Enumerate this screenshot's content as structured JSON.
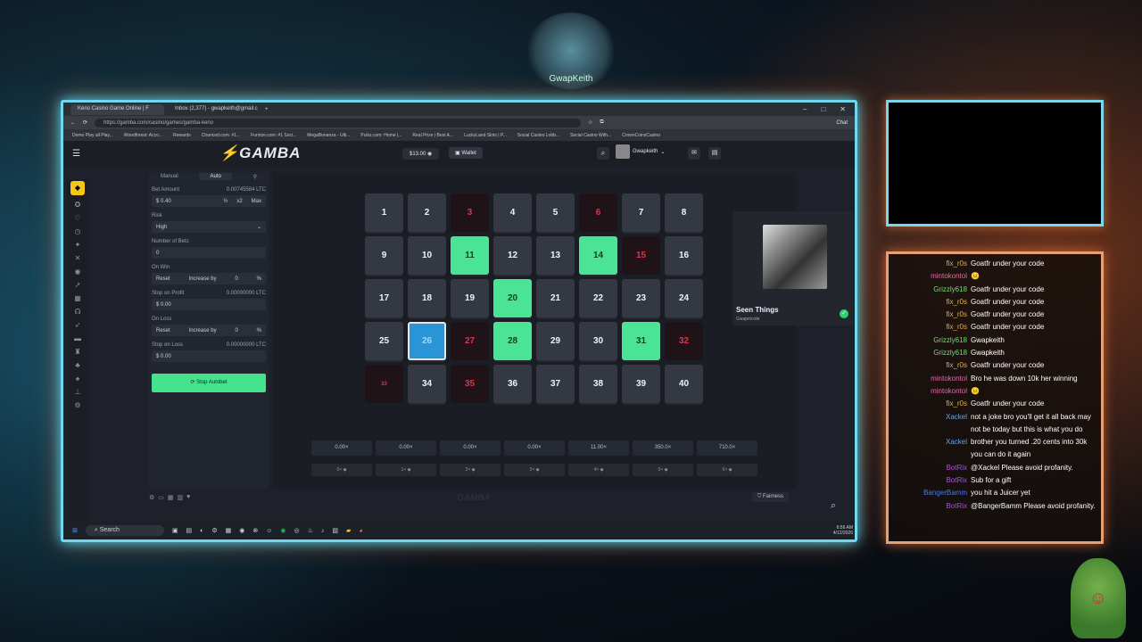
{
  "stream": {
    "logo_text": "GwapKeith"
  },
  "browser": {
    "tabs": [
      {
        "label": "Keno Casino Game Online | F"
      },
      {
        "label": "Inbox (2,377) - gwapkeith@gmail.c"
      }
    ],
    "url": "https://gamba.com/casino/games/gamba-keno",
    "bookmarks": [
      "Demo Play all Play...",
      "Woodforest: Acco...",
      "Rewards",
      "Chanced.com: #1...",
      "Funrize.com: #1 Soci...",
      "MegaBonanza - Ulti...",
      "Pulsz.com: Home |...",
      "Real Prize | Best A...",
      "LuckyLand Slots | P...",
      "Social Casino Lobb...",
      "Social Casino With...",
      "CrownCoinsCasino"
    ],
    "chat_label": "Chat"
  },
  "site": {
    "brand": "GAMBA",
    "balance": "$13.00",
    "wallet_label": "Wallet",
    "username": "Gwapkeith"
  },
  "bet_panel": {
    "tab_manual": "Manual",
    "tab_auto": "Auto",
    "bet_amount_label": "Bet Amount",
    "bet_amount_ltc": "0.00745584 LTC",
    "bet_amount_value": "$ 0.40",
    "half": "½",
    "double": "x2",
    "max": "Max",
    "risk_label": "Risk",
    "risk_value": "High",
    "num_bets_label": "Number of Bets",
    "num_bets_value": "0",
    "on_win_label": "On Win",
    "on_win_reset": "Reset",
    "on_win_increase": "Increase by",
    "on_win_value": "0",
    "on_win_pct": "%",
    "stop_profit_label": "Stop on Profit",
    "stop_profit_ltc": "0.00000000 LTC",
    "stop_profit_value": "$ 0.00",
    "on_loss_label": "On Loss",
    "on_loss_reset": "Reset",
    "on_loss_increase": "Increase by",
    "on_loss_value": "0",
    "on_loss_pct": "%",
    "stop_loss_label": "Stop on Loss",
    "stop_loss_ltc": "0.00000000 LTC",
    "stop_loss_value": "$ 0.00",
    "stop_button": "Stop Autobet"
  },
  "keno": {
    "cells": [
      {
        "n": "1",
        "s": ""
      },
      {
        "n": "2",
        "s": ""
      },
      {
        "n": "3",
        "s": "drawn"
      },
      {
        "n": "4",
        "s": ""
      },
      {
        "n": "5",
        "s": ""
      },
      {
        "n": "6",
        "s": "drawn"
      },
      {
        "n": "7",
        "s": ""
      },
      {
        "n": "8",
        "s": ""
      },
      {
        "n": "9",
        "s": ""
      },
      {
        "n": "10",
        "s": ""
      },
      {
        "n": "11",
        "s": "hit"
      },
      {
        "n": "12",
        "s": ""
      },
      {
        "n": "13",
        "s": ""
      },
      {
        "n": "14",
        "s": "hit"
      },
      {
        "n": "15",
        "s": "drawn"
      },
      {
        "n": "16",
        "s": ""
      },
      {
        "n": "17",
        "s": ""
      },
      {
        "n": "18",
        "s": ""
      },
      {
        "n": "19",
        "s": ""
      },
      {
        "n": "20",
        "s": "hit"
      },
      {
        "n": "21",
        "s": ""
      },
      {
        "n": "22",
        "s": ""
      },
      {
        "n": "23",
        "s": ""
      },
      {
        "n": "24",
        "s": ""
      },
      {
        "n": "25",
        "s": ""
      },
      {
        "n": "26",
        "s": "sel"
      },
      {
        "n": "27",
        "s": "drawn"
      },
      {
        "n": "28",
        "s": "hit"
      },
      {
        "n": "29",
        "s": ""
      },
      {
        "n": "30",
        "s": ""
      },
      {
        "n": "31",
        "s": "hit"
      },
      {
        "n": "32",
        "s": "drawn"
      },
      {
        "n": "33",
        "s": "drawn small"
      },
      {
        "n": "34",
        "s": ""
      },
      {
        "n": "35",
        "s": "drawn"
      },
      {
        "n": "36",
        "s": ""
      },
      {
        "n": "37",
        "s": ""
      },
      {
        "n": "38",
        "s": ""
      },
      {
        "n": "39",
        "s": ""
      },
      {
        "n": "40",
        "s": ""
      }
    ],
    "multipliers": [
      "0.00×",
      "0.00×",
      "0.00×",
      "0.00×",
      "11.00×",
      "350.0×",
      "710.0×"
    ],
    "hit_counts": [
      "0×",
      "1×",
      "2×",
      "3×",
      "4×",
      "5×",
      "6×"
    ],
    "fairness": "Fairness",
    "watermark": "GAMBA"
  },
  "now_playing": {
    "title": "Seen Things",
    "artist": "Gwapmixde"
  },
  "taskbar": {
    "search": "Search",
    "time": "6:56 AM",
    "date": "4/12/2026"
  },
  "chat": [
    {
      "name": "fix_r0s",
      "color": "#e8b04a",
      "text": "Goatfr under your code"
    },
    {
      "name": "mintokontol",
      "color": "#e06aa6",
      "text": "😐"
    },
    {
      "name": "Grizzly618",
      "color": "#6ae06a",
      "text": "Goatfr under your code"
    },
    {
      "name": "fix_r0s",
      "color": "#e8b04a",
      "text": "Goatfr under your code"
    },
    {
      "name": "fix_r0s",
      "color": "#e8b04a",
      "text": "Goatfr under your code"
    },
    {
      "name": "fix_r0s",
      "color": "#e8b04a",
      "text": "Goatfr under your code"
    },
    {
      "name": "Grizzly618",
      "color": "#6ae06a",
      "text": "Gwapkeith"
    },
    {
      "name": "Grizzly618",
      "color": "#6ae06a",
      "text": "Gwapkeith"
    },
    {
      "name": "fix_r0s",
      "color": "#e8b04a",
      "text": "Goatfr under your code"
    },
    {
      "name": "mintokontol",
      "color": "#e06aa6",
      "text": "Bro he was down 10k her winning"
    },
    {
      "name": "mintokontol",
      "color": "#e06aa6",
      "text": "😐"
    },
    {
      "name": "fix_r0s",
      "color": "#e8b04a",
      "text": "Goatfr under your code"
    },
    {
      "name": "Xackel",
      "color": "#6aa0e0",
      "text": "not a joke bro you'll get it all back may not be today but this is what you do"
    },
    {
      "name": "Xackel",
      "color": "#6aa0e0",
      "text": "brother you turned .20 cents into 30k you can do it again"
    },
    {
      "name": "BotRix",
      "color": "#b04ae8",
      "text": "@Xackel Please avoid profanity."
    },
    {
      "name": "BotRix",
      "color": "#b04ae8",
      "text": "Sub for a gift"
    },
    {
      "name": "BangerBamm",
      "color": "#4a7ae8",
      "text": "you hit a Juicer yet"
    },
    {
      "name": "BotRix",
      "color": "#b04ae8",
      "text": "@BangerBamm Please avoid profanity."
    }
  ]
}
